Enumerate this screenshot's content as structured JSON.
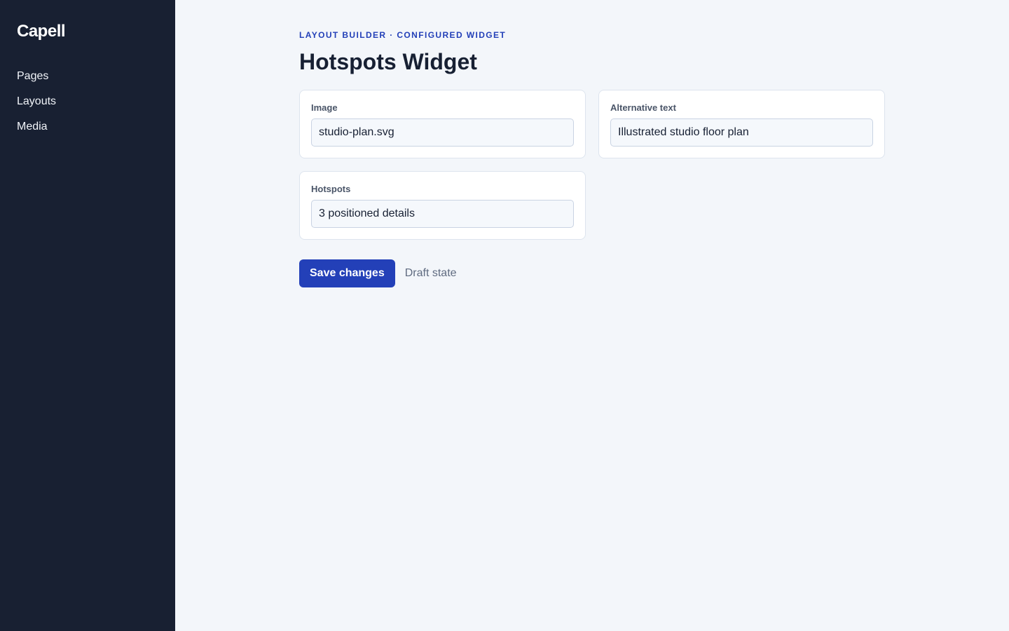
{
  "sidebar": {
    "brand": "Capell",
    "items": [
      {
        "label": "Pages"
      },
      {
        "label": "Layouts"
      },
      {
        "label": "Media"
      }
    ]
  },
  "header": {
    "eyebrow": "LAYOUT BUILDER · CONFIGURED WIDGET",
    "title": "Hotspots Widget"
  },
  "fields": {
    "image": {
      "label": "Image",
      "value": "studio-plan.svg"
    },
    "alt_text": {
      "label": "Alternative text",
      "value": "Illustrated studio floor plan"
    },
    "hotspots": {
      "label": "Hotspots",
      "value": "3 positioned details"
    }
  },
  "actions": {
    "save_label": "Save changes",
    "status": "Draft state"
  },
  "colors": {
    "sidebar_bg": "#182032",
    "page_bg": "#f3f6fa",
    "accent": "#2340b8"
  }
}
